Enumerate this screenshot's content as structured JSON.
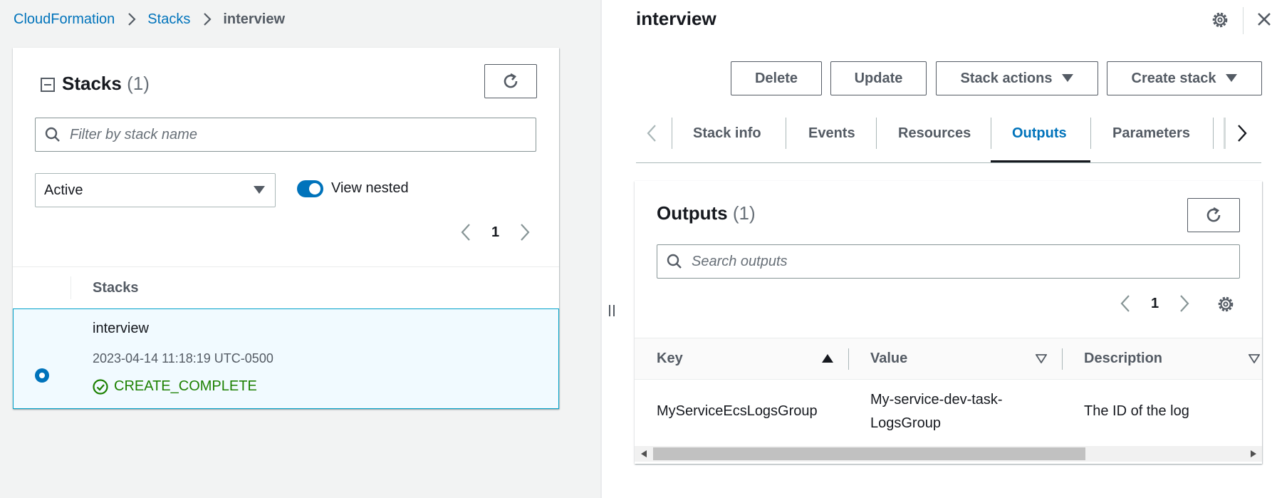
{
  "breadcrumb": {
    "items": [
      "CloudFormation",
      "Stacks"
    ],
    "current": "interview"
  },
  "stacks_panel": {
    "title": "Stacks",
    "count": "(1)",
    "search_placeholder": "Filter by stack name",
    "filter_value": "Active",
    "view_nested_label": "View nested",
    "view_nested_on": true,
    "page": "1",
    "column_header": "Stacks",
    "rows": [
      {
        "name": "interview",
        "timestamp": "2023-04-14 11:18:19 UTC-0500",
        "status": "CREATE_COMPLETE",
        "selected": true
      }
    ]
  },
  "detail": {
    "title": "interview",
    "buttons": {
      "delete": "Delete",
      "update": "Update",
      "stack_actions": "Stack actions",
      "create_stack": "Create stack"
    },
    "tabs": [
      "Stack info",
      "Events",
      "Resources",
      "Outputs",
      "Parameters"
    ],
    "active_tab": "Outputs"
  },
  "outputs": {
    "title": "Outputs",
    "count": "(1)",
    "search_placeholder": "Search outputs",
    "page": "1",
    "columns": [
      "Key",
      "Value",
      "Description"
    ],
    "rows": [
      {
        "key": "MyServiceEcsLogsGroup",
        "value_line1": "My-service-dev-task-",
        "value_line2": "LogsGroup",
        "description": "The ID of the log"
      }
    ]
  },
  "colors": {
    "link": "#0073bb",
    "status_success": "#1d8102",
    "selected_row_bg": "#f1faff",
    "selected_row_border": "#00a1c9"
  }
}
